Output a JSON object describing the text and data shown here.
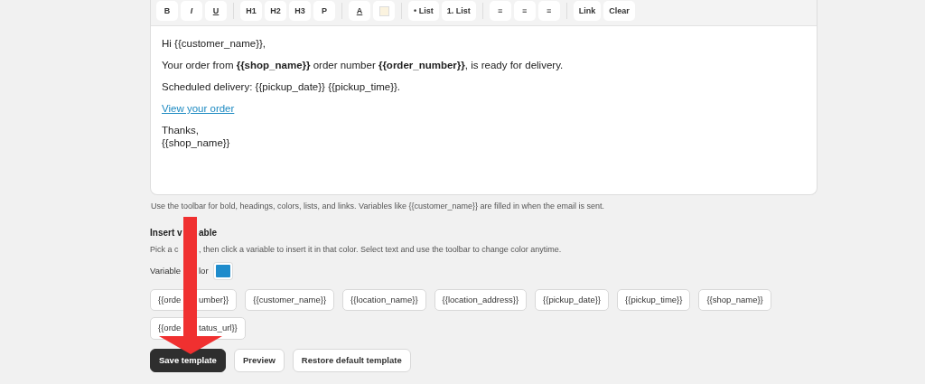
{
  "toolbar": {
    "groups": [
      [
        {
          "kind": "text",
          "label": "B"
        },
        {
          "kind": "text",
          "label": "I"
        },
        {
          "kind": "text",
          "label": "U"
        }
      ],
      [
        {
          "kind": "text",
          "label": "H1"
        },
        {
          "kind": "text",
          "label": "H2"
        },
        {
          "kind": "text",
          "label": "H3"
        },
        {
          "kind": "text",
          "label": "P"
        }
      ],
      [
        {
          "kind": "text",
          "label": "A"
        },
        {
          "kind": "swatch",
          "color": "#fbf3df"
        }
      ],
      [
        {
          "kind": "text",
          "label": "• List"
        },
        {
          "kind": "text",
          "label": "1. List"
        }
      ],
      [
        {
          "kind": "text",
          "label": "≡"
        },
        {
          "kind": "text",
          "label": "≡"
        },
        {
          "kind": "text",
          "label": "≡"
        }
      ],
      [
        {
          "kind": "text",
          "label": "Link"
        },
        {
          "kind": "text",
          "label": "Clear"
        }
      ]
    ]
  },
  "editor": {
    "paragraphs": [
      {
        "kind": "text",
        "lines": [
          "Hi {{customer_name}},"
        ]
      },
      {
        "kind": "text",
        "lines": [
          "Your order from **{{shop_name}}** order number **{{order_number}}**, is ready for delivery."
        ]
      },
      {
        "kind": "text",
        "lines": [
          "Scheduled delivery: {{pickup_date}} {{pickup_time}}."
        ]
      },
      {
        "kind": "link",
        "lines": [
          "View your order"
        ]
      },
      {
        "kind": "text",
        "lines": [
          "Thanks,",
          "{{shop_name}}"
        ]
      }
    ]
  },
  "help_text": "Use the toolbar for bold, headings, colors, lists, and links. Variables like {{customer_name}} are filled in when the email is sent.",
  "insert_variable": {
    "title": [
      "Insert v",
      "able"
    ],
    "description": [
      "Pick a c",
      ", then click a variable to insert it in that color. Select text and use the toolbar to change color anytime."
    ],
    "color_label": [
      "Variable",
      "lor"
    ],
    "color": "#1f8ccc",
    "variables": [
      {
        "parts": [
          "{{orde",
          "umber}}"
        ]
      },
      {
        "parts": [
          "{{customer_name}}"
        ]
      },
      {
        "parts": [
          "{{location_name}}"
        ]
      },
      {
        "parts": [
          "{{location_address}}"
        ]
      },
      {
        "parts": [
          "{{pickup_date}}"
        ]
      },
      {
        "parts": [
          "{{pickup_time}}"
        ]
      },
      {
        "parts": [
          "{{shop_name}}"
        ]
      },
      {
        "parts": [
          "{{orde",
          "tatus_url}}"
        ]
      }
    ]
  },
  "actions": [
    {
      "label": "Save template",
      "kind": "primary"
    },
    {
      "label": "Preview",
      "kind": "secondary"
    },
    {
      "label": "Restore default template",
      "kind": "secondary"
    }
  ],
  "annotation": {
    "kind": "arrow",
    "color": "#f03030"
  }
}
